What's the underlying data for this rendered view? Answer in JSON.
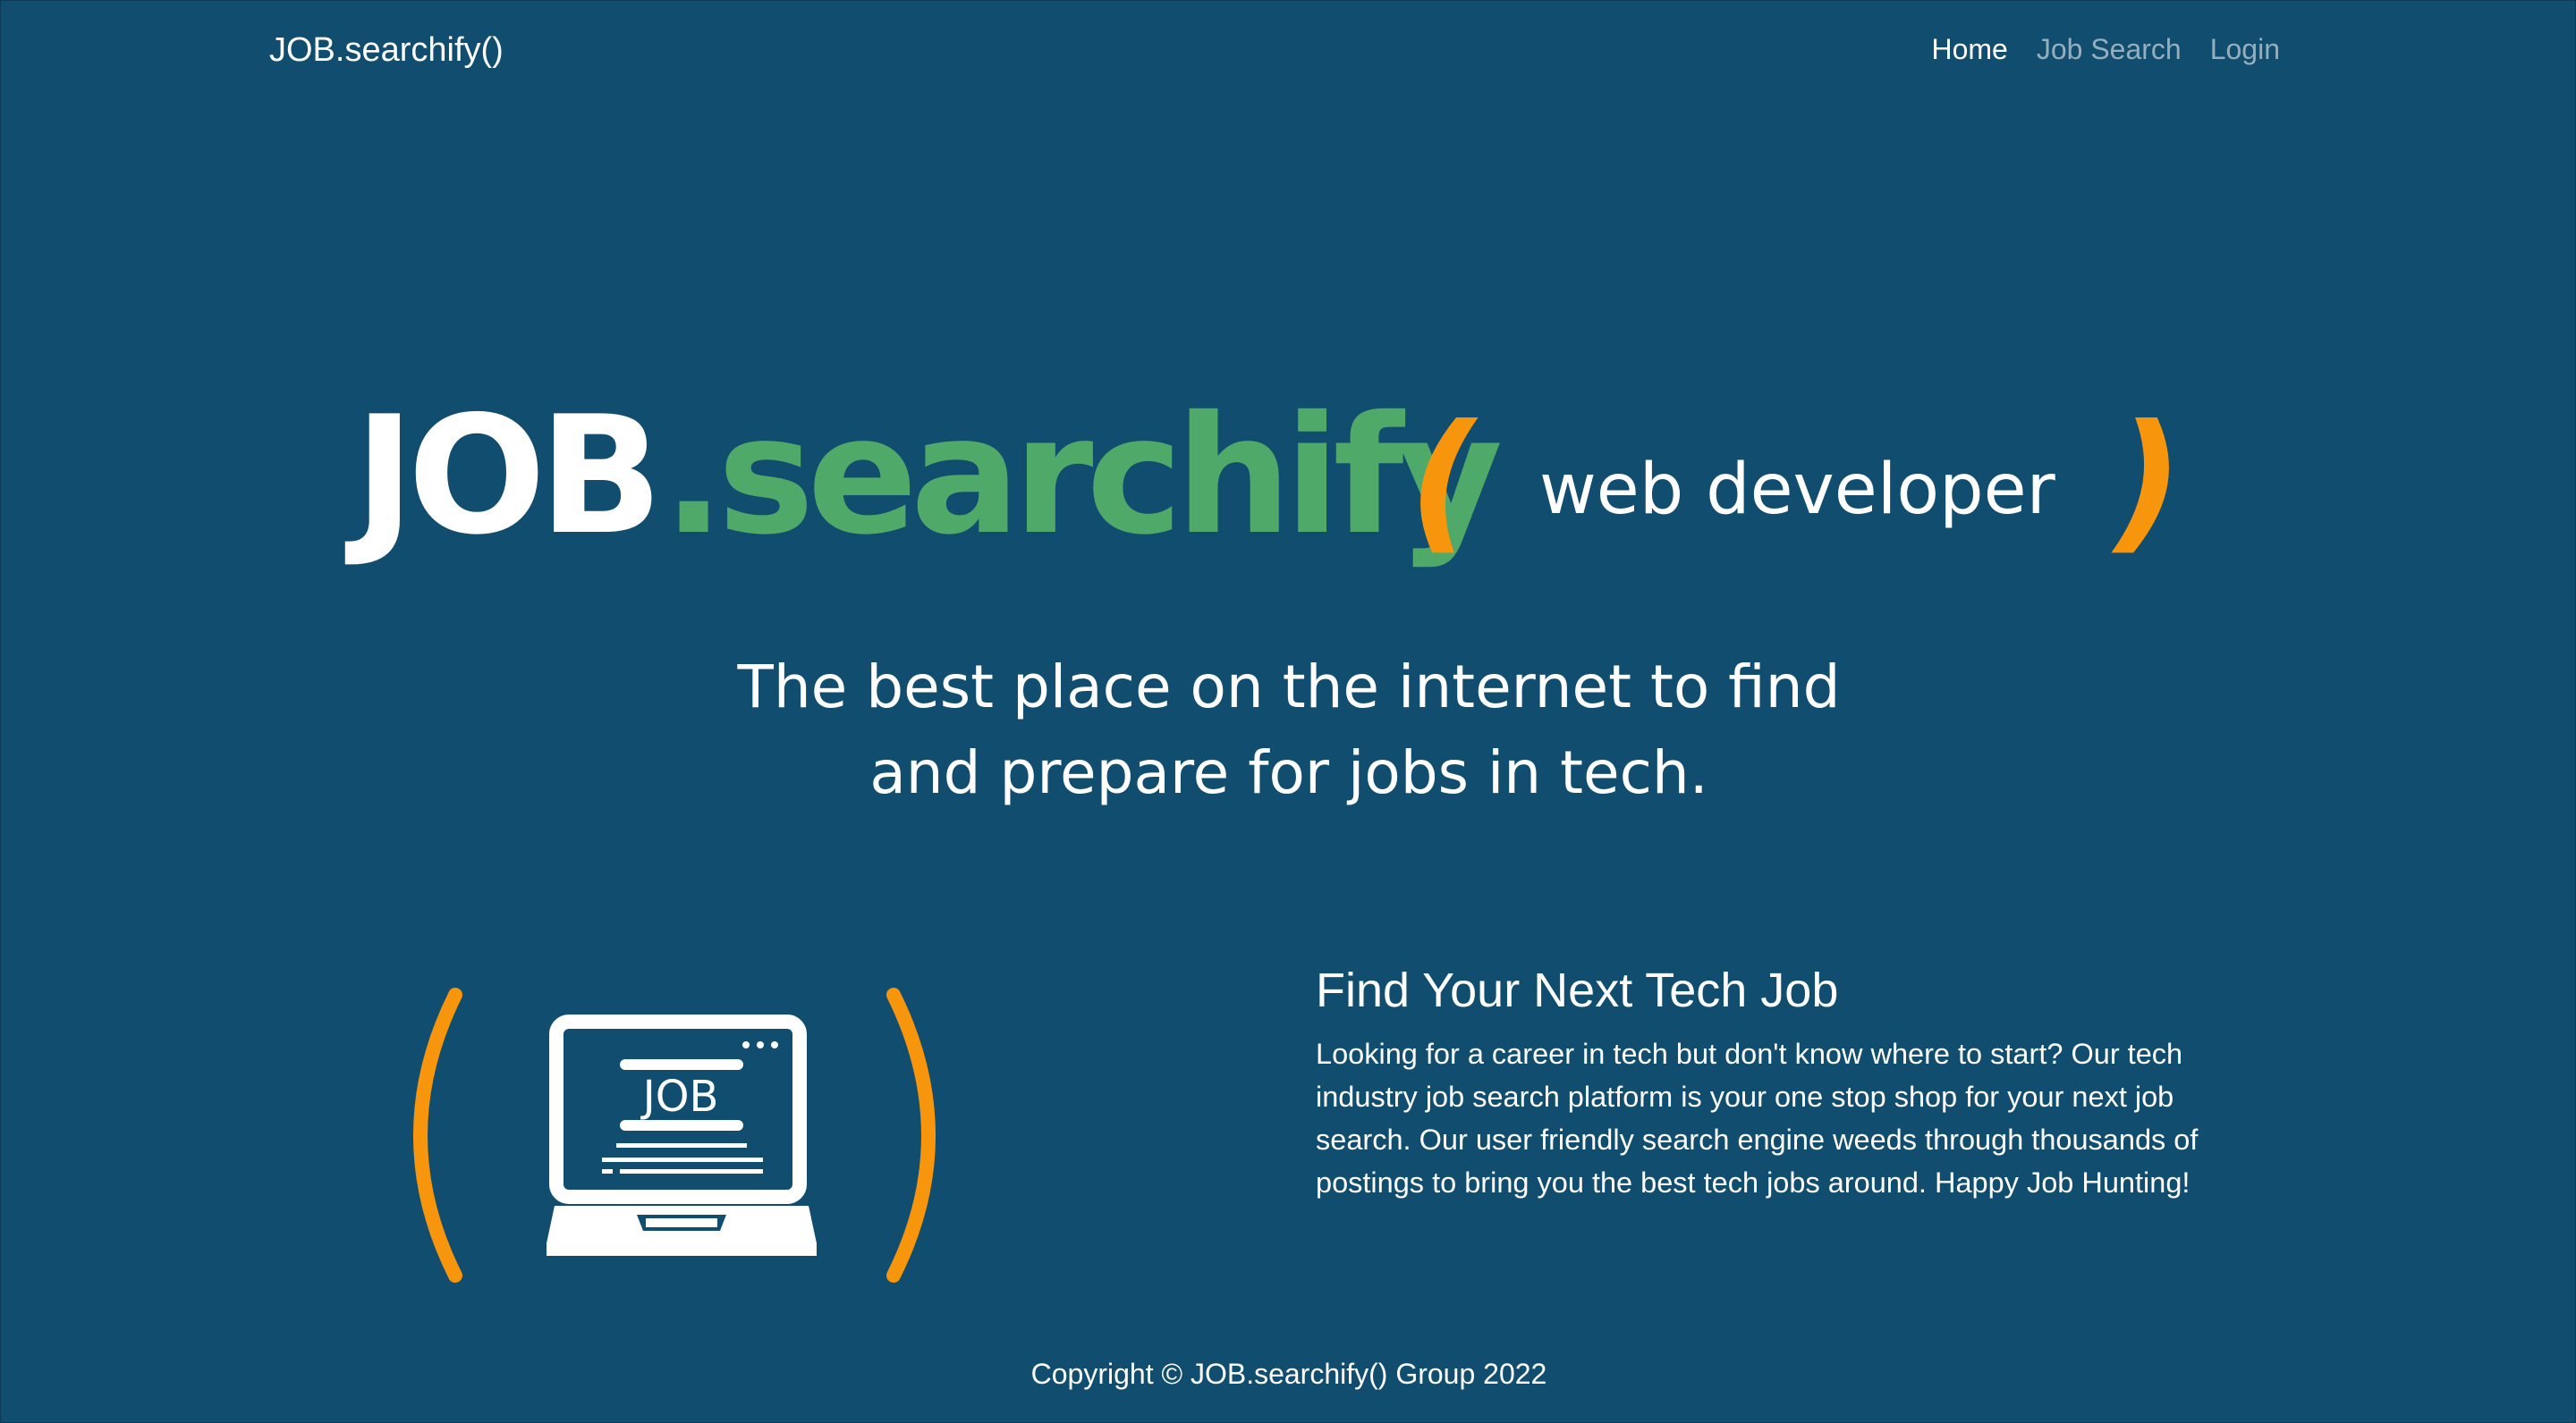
{
  "navbar": {
    "brand": "JOB.searchify()",
    "links": [
      {
        "label": "Home",
        "active": true
      },
      {
        "label": "Job Search",
        "active": false
      },
      {
        "label": "Login",
        "active": false
      }
    ]
  },
  "hero": {
    "logo_part1": "JOB",
    "logo_part2": ".searchify",
    "paren_open": "(",
    "paren_close": ")",
    "role": "web developer",
    "tagline_line1": "The best place on the internet to find",
    "tagline_line2": "and prepare for jobs in tech."
  },
  "illustration": {
    "screen_text": "JOB",
    "icon": "laptop-icon"
  },
  "feature": {
    "title": "Find Your Next Tech Job",
    "body": "Looking for a career in tech but don't know where to start? Our tech industry job search platform is your one stop shop for your next job search. Our user friendly search engine weeds through thousands of postings to bring you the best tech jobs around. Happy Job Hunting!"
  },
  "footer": {
    "copyright": "Copyright © JOB.searchify() Group 2022"
  },
  "colors": {
    "background": "#114d6e",
    "accent_green": "#4faa6a",
    "accent_orange": "#f7950d",
    "text": "#ffffff"
  }
}
